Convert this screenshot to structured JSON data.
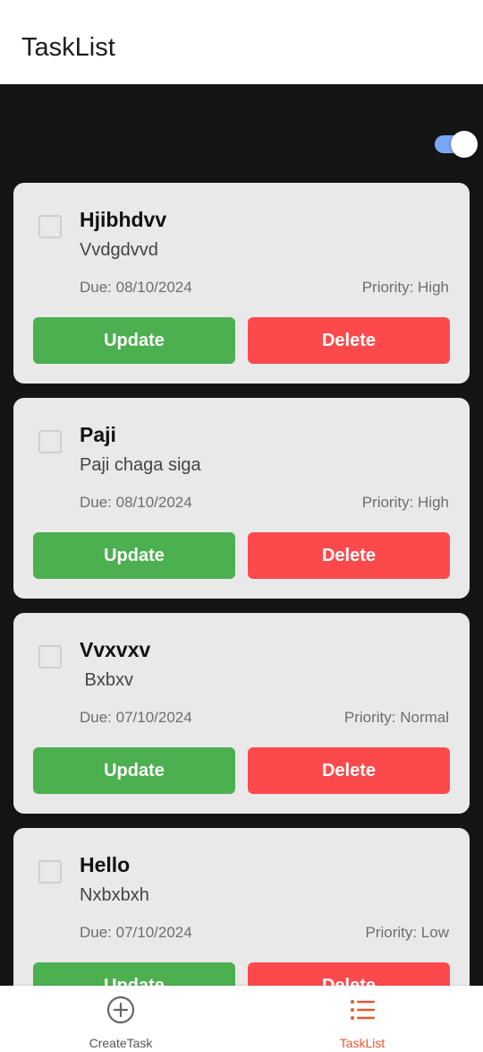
{
  "header": {
    "title": "TaskList"
  },
  "settings": {
    "toggle_on": true,
    "toggle_color": "#7aa7f5"
  },
  "tasks": [
    {
      "title": "Hjibhdvv",
      "description": "Vvdgdvvd",
      "due": "Due: 08/10/2024",
      "priority": "Priority: High",
      "checked": false,
      "update_label": "Update",
      "delete_label": "Delete"
    },
    {
      "title": "Paji",
      "description": "Paji chaga siga",
      "due": "Due: 08/10/2024",
      "priority": "Priority: High",
      "checked": false,
      "update_label": "Update",
      "delete_label": "Delete"
    },
    {
      "title": "Vvxvxv",
      "description": " Bxbxv",
      "due": "Due: 07/10/2024",
      "priority": "Priority: Normal",
      "checked": false,
      "update_label": "Update",
      "delete_label": "Delete"
    },
    {
      "title": "Hello",
      "description": "Nxbxbxh",
      "due": "Due: 07/10/2024",
      "priority": "Priority: Low",
      "checked": false,
      "update_label": "Update",
      "delete_label": "Delete"
    }
  ],
  "bottom_nav": {
    "items": [
      {
        "label": "CreateTask",
        "icon": "add-circle-icon",
        "active": false
      },
      {
        "label": "TaskList",
        "icon": "list-icon",
        "active": true
      }
    ],
    "active_color": "#e8572f",
    "inactive_color": "#555555"
  },
  "colors": {
    "update_button": "#4caf50",
    "delete_button": "#fc4a4c",
    "background": "#141414",
    "card": "#e9e9e9"
  }
}
